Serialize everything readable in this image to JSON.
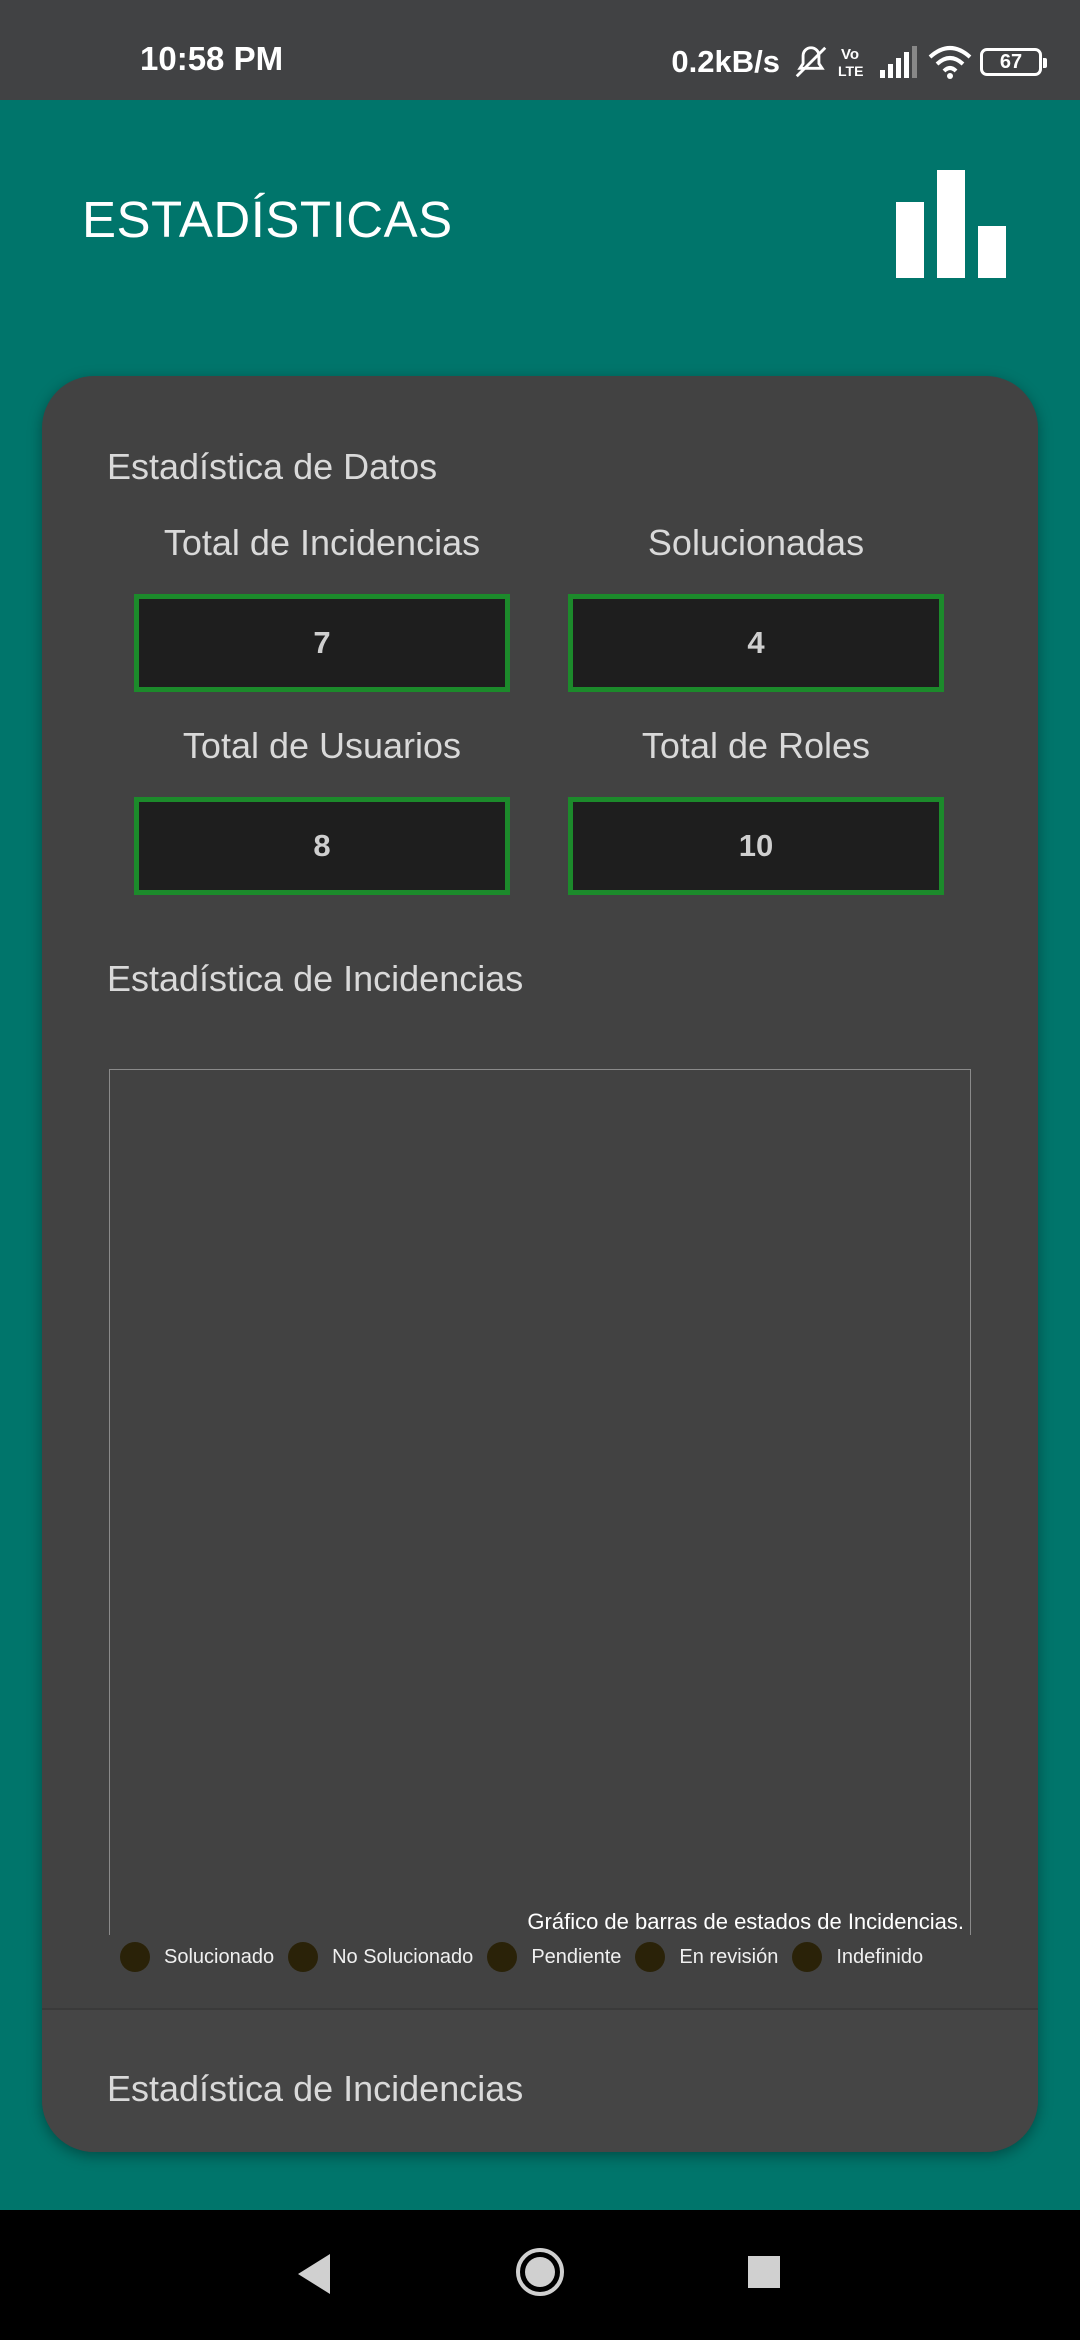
{
  "status_bar": {
    "time": "10:58 PM",
    "net_speed": "0.2kB/s",
    "volte": "Vo\nLTE",
    "battery": "67",
    "icons": [
      "mute-bell-icon",
      "volte-icon",
      "signal-icon",
      "wifi-icon",
      "battery-icon"
    ]
  },
  "header": {
    "title": "ESTADÍSTICAS",
    "icon": "bar-chart-icon"
  },
  "datos": {
    "title": "Estadística de Datos",
    "stats": [
      {
        "label": "Total de Incidencias",
        "value": "7"
      },
      {
        "label": "Solucionadas",
        "value": "4"
      },
      {
        "label": "Total de Usuarios",
        "value": "8"
      },
      {
        "label": "Total de Roles",
        "value": "10"
      }
    ]
  },
  "incidencias": {
    "title": "Estadística de Incidencias",
    "chart_description": "Gráfico de barras de estados de Incidencias.",
    "legend": [
      "Solucionado",
      "No Solucionado",
      "Pendiente",
      "En revisión",
      "Indefinido"
    ]
  },
  "footer_section": {
    "title": "Estadística de Incidencias"
  },
  "colors": {
    "primary": "#00756b",
    "card": "#424242",
    "stat_border": "#1c8a2b",
    "stat_bg": "#1e1e1e"
  }
}
